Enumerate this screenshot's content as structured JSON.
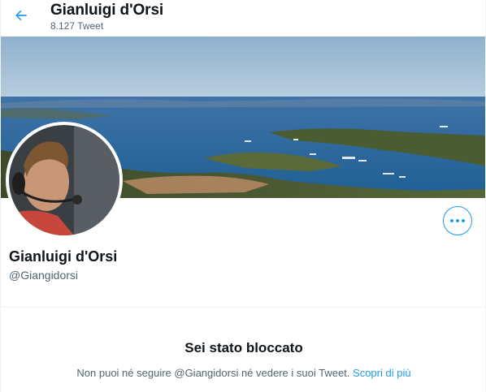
{
  "header": {
    "back_icon": "arrow-left-icon",
    "name": "Gianluigi d'Orsi",
    "tweet_count": "8.127 Tweet"
  },
  "profile": {
    "name": "Gianluigi d'Orsi",
    "handle": "@Giangidorsi",
    "more_icon": "more-horizontal-icon"
  },
  "blocked": {
    "title": "Sei stato bloccato",
    "message": "Non puoi né seguire @Giangidorsi né vedere i suoi Tweet.",
    "link": "Scopri di più"
  },
  "colors": {
    "accent": "#1d9bf0",
    "secondary_text": "#536471",
    "primary_text": "#0f1419"
  }
}
